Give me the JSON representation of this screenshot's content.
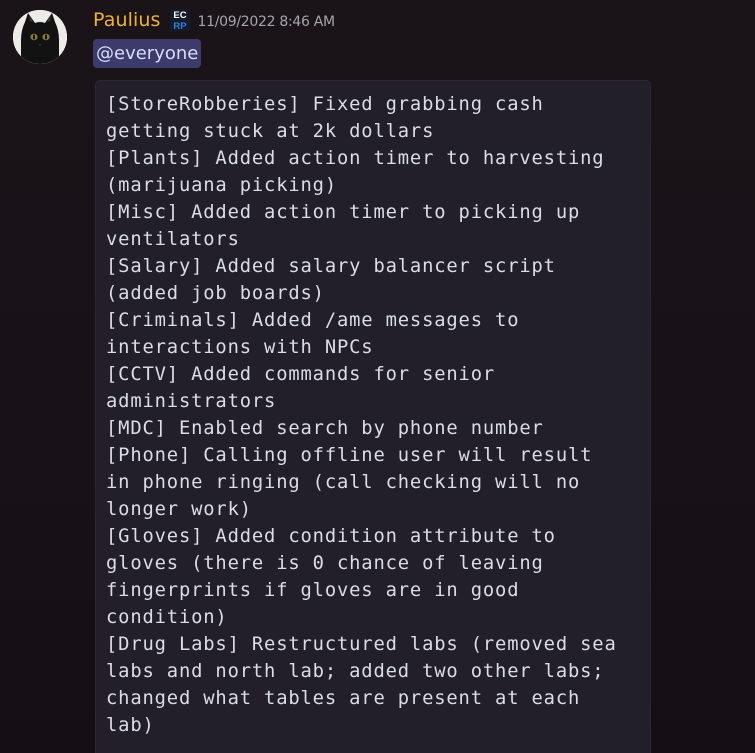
{
  "message": {
    "author": "Paulius",
    "server_tag_text": "EC RP",
    "timestamp": "11/09/2022 8:46 AM",
    "mention": "@everyone",
    "code_block": "[StoreRobberies] Fixed grabbing cash\ngetting stuck at 2k dollars\n[Plants] Added action timer to harvesting\n(marijuana picking)\n[Misc] Added action timer to picking up\nventilators\n[Salary] Added salary balancer script\n(added job boards)\n[Criminals] Added /ame messages to\ninteractions with NPCs\n[CCTV] Added commands for senior\nadministrators\n[MDC] Enabled search by phone number\n[Phone] Calling offline user will result\nin phone ringing (call checking will no\nlonger work)\n[Gloves] Added condition attribute to\ngloves (there is 0 chance of leaving\nfingerprints if gloves are in good\ncondition)\n[Drug Labs] Restructured labs (removed sea\nlabs and north lab; added two other labs;\nchanged what tables are present at each\nlab)"
  },
  "icons": {
    "avatar": "black-cat-avatar",
    "server_tag": "ecrp-server-tag-icon"
  },
  "colors": {
    "background": "#1a1419",
    "username": "#f0b232",
    "timestamp": "#a3a6aa",
    "mention_bg": "#3c3b6b",
    "mention_text": "#d9ddff",
    "code_bg": "#221f2b",
    "code_text": "#dbdee1"
  }
}
